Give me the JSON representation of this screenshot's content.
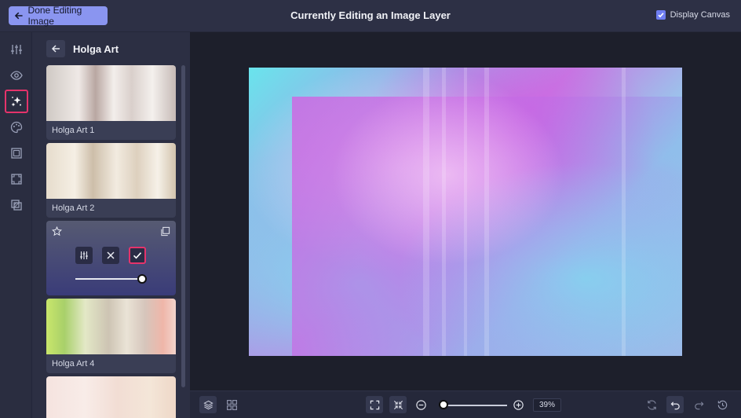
{
  "topbar": {
    "done_label": "Done Editing Image",
    "title": "Currently Editing an Image Layer",
    "display_canvas_label": "Display Canvas",
    "display_canvas_checked": true
  },
  "rail": {
    "icons": [
      "adjust-icon",
      "eye-icon",
      "effects-icon",
      "palette-icon",
      "frame-icon",
      "crop-icon",
      "overlay-icon"
    ],
    "active": "effects-icon"
  },
  "panel": {
    "title": "Holga Art",
    "cards": [
      {
        "label": "Holga Art 1"
      },
      {
        "label": "Holga Art 2"
      },
      {
        "label": "",
        "selected": true,
        "intensity": 1.0
      },
      {
        "label": "Holga Art 4"
      },
      {
        "label": ""
      }
    ]
  },
  "bottombar": {
    "zoom_value": "39%",
    "zoom_level": 0.05
  },
  "colors": {
    "accent": "#8a95f0",
    "highlight": "#e5336b",
    "background": "#1d1f2b"
  }
}
